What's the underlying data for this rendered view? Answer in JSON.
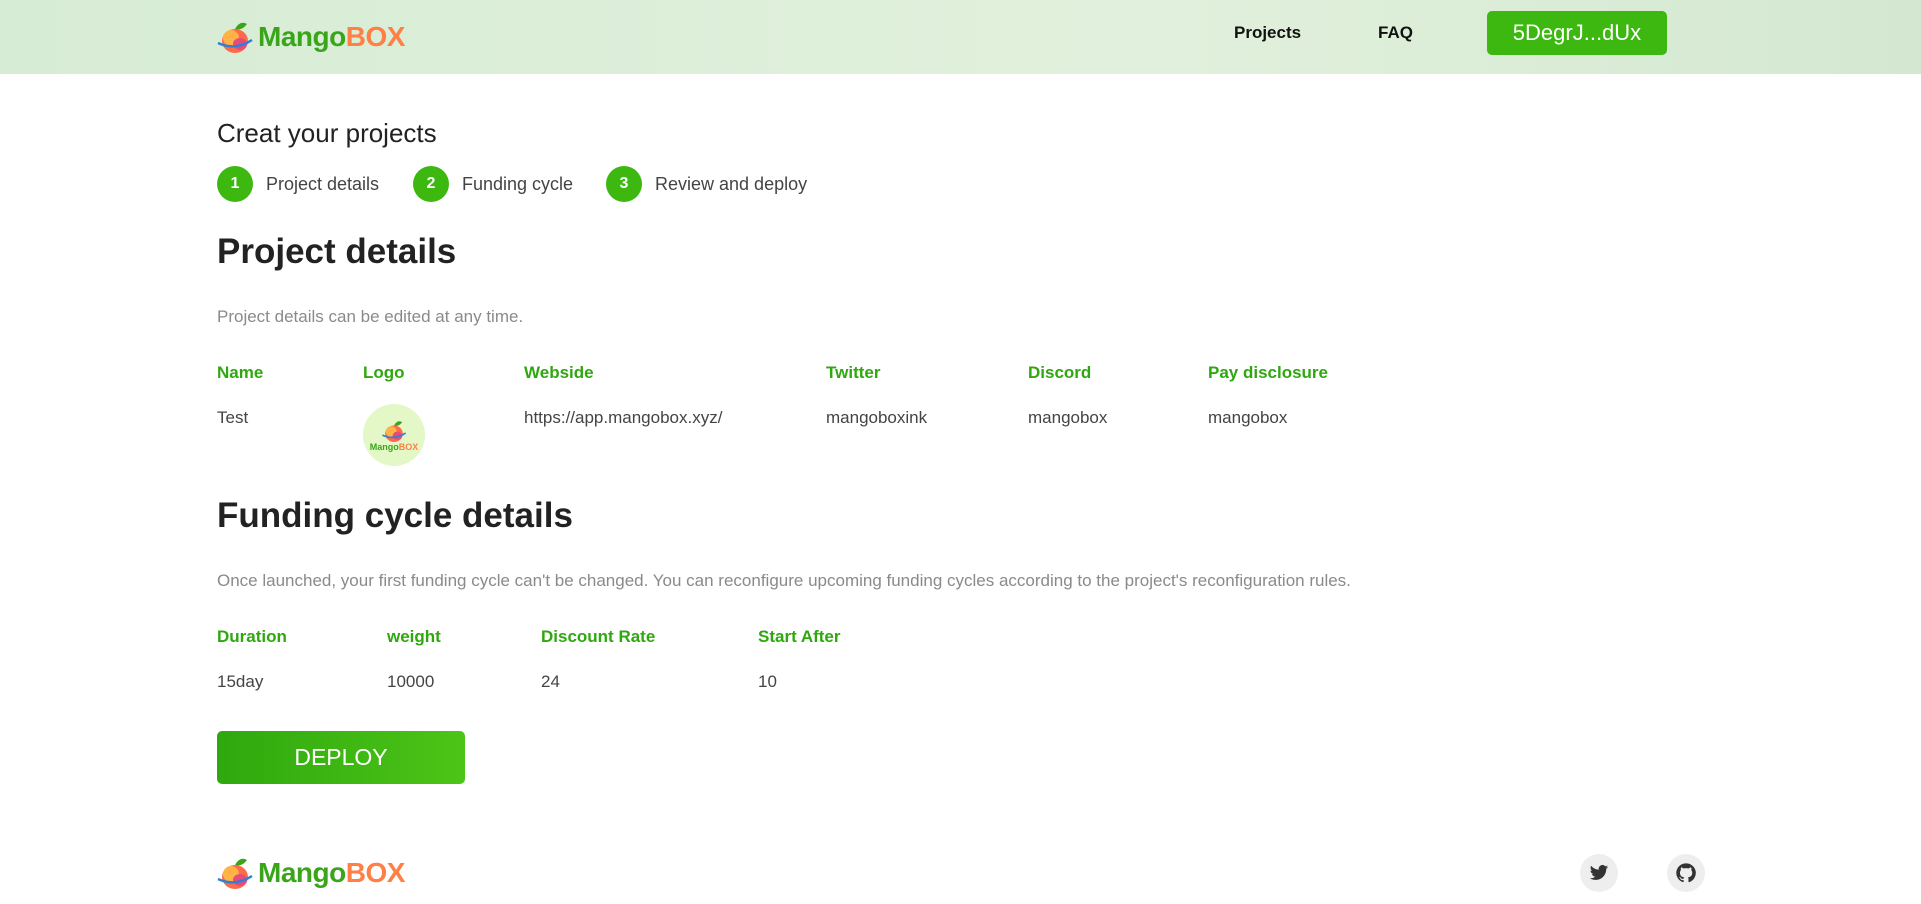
{
  "header": {
    "brand": {
      "part1": "Mango",
      "part2": "BOX"
    },
    "nav": {
      "projects": "Projects",
      "faq": "FAQ"
    },
    "wallet": "5DegrJ...dUx"
  },
  "page_title": "Creat your projects",
  "steps": [
    {
      "num": "1",
      "label": "Project details"
    },
    {
      "num": "2",
      "label": "Funding cycle"
    },
    {
      "num": "3",
      "label": "Review and deploy"
    }
  ],
  "project": {
    "heading": "Project details",
    "description": "Project details can be edited at any time.",
    "columns": {
      "name": "Name",
      "logo": "Logo",
      "website": "Webside",
      "twitter": "Twitter",
      "discord": "Discord",
      "pay_disclosure": "Pay disclosure"
    },
    "values": {
      "name": "Test",
      "website": "https://app.mangobox.xyz/",
      "twitter": "mangoboxink",
      "discord": "mangobox",
      "pay_disclosure": "mangobox"
    },
    "logo_text": {
      "part1": "Mango",
      "part2": "BOX"
    }
  },
  "funding": {
    "heading": "Funding cycle details",
    "description": "Once launched, your first funding cycle can't be changed. You can reconfigure upcoming funding cycles according to the project's reconfiguration rules.",
    "columns": {
      "duration": "Duration",
      "weight": "weight",
      "discount_rate": "Discount Rate",
      "start_after": "Start After"
    },
    "values": {
      "duration": "15day",
      "weight": "10000",
      "discount_rate": "24",
      "start_after": "10"
    }
  },
  "deploy_label": "DEPLOY",
  "footer": {
    "brand": {
      "part1": "Mango",
      "part2": "BOX"
    }
  },
  "icons": {
    "social": [
      "twitter-icon",
      "github-icon"
    ]
  },
  "colors": {
    "accent": "#3cb810",
    "label_green": "#2fa80f",
    "brand_orange": "#ff7f45"
  }
}
